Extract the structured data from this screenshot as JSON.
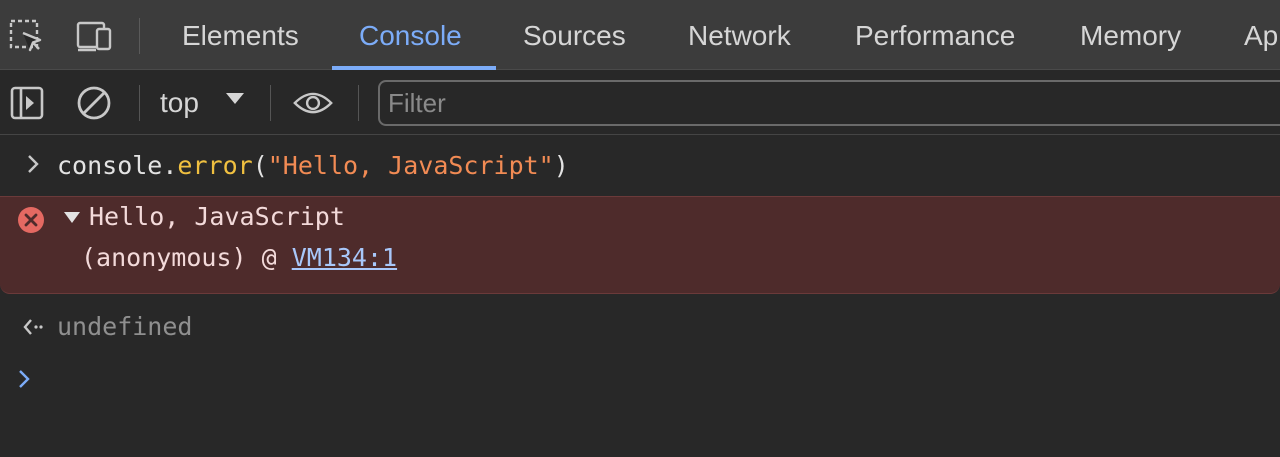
{
  "tabs": {
    "items": [
      {
        "label": "Elements"
      },
      {
        "label": "Console"
      },
      {
        "label": "Sources"
      },
      {
        "label": "Network"
      },
      {
        "label": "Performance"
      },
      {
        "label": "Memory"
      },
      {
        "label": "Ap"
      }
    ],
    "active_index": 1
  },
  "toolbar": {
    "context_label": "top",
    "filter_placeholder": "Filter"
  },
  "console": {
    "input": {
      "object": "console",
      "dot": ".",
      "method": "error",
      "open_paren": "(",
      "string_arg": "\"Hello, JavaScript\"",
      "close_paren": ")"
    },
    "error": {
      "message": "Hello, JavaScript",
      "trace_prefix": "(anonymous) @ ",
      "trace_link": "VM134:1"
    },
    "return_value": "undefined"
  },
  "colors": {
    "accent": "#7cacf8",
    "error_background": "#4e2b2b",
    "error_icon": "#e46962",
    "string_token": "#f28b54",
    "method_token": "#f0c040",
    "link": "#a8c7fa"
  },
  "icons": [
    "inspect-element-icon",
    "device-toolbar-icon",
    "sidebar-toggle-icon",
    "clear-console-icon",
    "dropdown-arrow-icon",
    "eye-icon",
    "error-icon",
    "expand-triangle-icon",
    "input-chevron-icon",
    "return-arrow-icon",
    "prompt-chevron-icon"
  ]
}
